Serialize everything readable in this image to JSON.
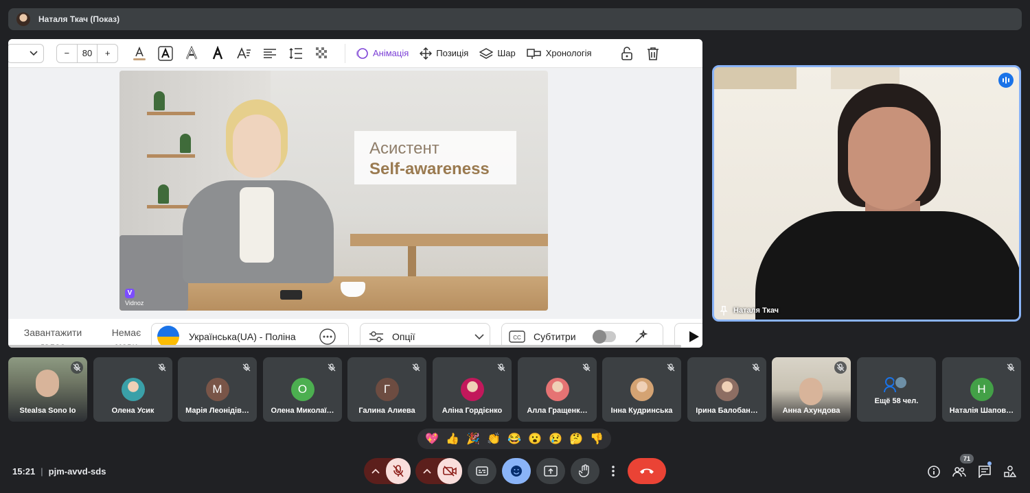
{
  "header": {
    "presenter_title": "Наталя Ткач (Показ)"
  },
  "editor": {
    "font_size": "80",
    "minus": "−",
    "plus": "+",
    "buttons": {
      "animation": "Анімація",
      "position": "Позиція",
      "layer": "Шар",
      "timeline": "Хронологія"
    }
  },
  "slide": {
    "title_line1": "Асистент",
    "title_line2": "Self-awareness",
    "watermark": "Vidnoz"
  },
  "controls": {
    "upload_voice": "Завантажити голос",
    "no_language": "Немає мови",
    "voice": "Українська(UA) - Поліна",
    "options": "Опції",
    "subtitles": "Субтитри"
  },
  "speaker": {
    "name": "Наталя Ткач"
  },
  "participants": [
    {
      "name": "Stealsa Sono Io",
      "type": "video"
    },
    {
      "name": "Олена Усик",
      "type": "photo",
      "color": "#3aa0a8"
    },
    {
      "name": "Марія Леонідів…",
      "type": "letter",
      "letter": "М",
      "color": "#795548"
    },
    {
      "name": "Олена Миколаї…",
      "type": "letter",
      "letter": "О",
      "color": "#4caf50"
    },
    {
      "name": "Галина Алиева",
      "type": "letter",
      "letter": "Г",
      "color": "#6d4c41"
    },
    {
      "name": "Аліна Гордієнко",
      "type": "photo",
      "color": "#c2185b"
    },
    {
      "name": "Алла Гращенк…",
      "type": "photo",
      "color": "#e57373"
    },
    {
      "name": "Інна Кудринська",
      "type": "photo",
      "color": "#d4a373"
    },
    {
      "name": "Ірина Балобан…",
      "type": "photo",
      "color": "#8d6e63"
    },
    {
      "name": "Анна Ахундова",
      "type": "video"
    },
    {
      "name": "Ещё 58 чел.",
      "type": "more"
    },
    {
      "name": "Наталія Шапов…",
      "type": "letter",
      "letter": "Н",
      "color": "#43a047"
    }
  ],
  "reactions": [
    "💖",
    "👍",
    "🎉",
    "👏",
    "😂",
    "😮",
    "😢",
    "🤔",
    "👎"
  ],
  "bottom": {
    "time": "15:21",
    "meeting_code": "pjm-avvd-sds",
    "people_count": "71"
  },
  "colors": {
    "accent": "#8ab4f8",
    "end_call": "#ea4335",
    "animation": "#7b3fd6"
  }
}
